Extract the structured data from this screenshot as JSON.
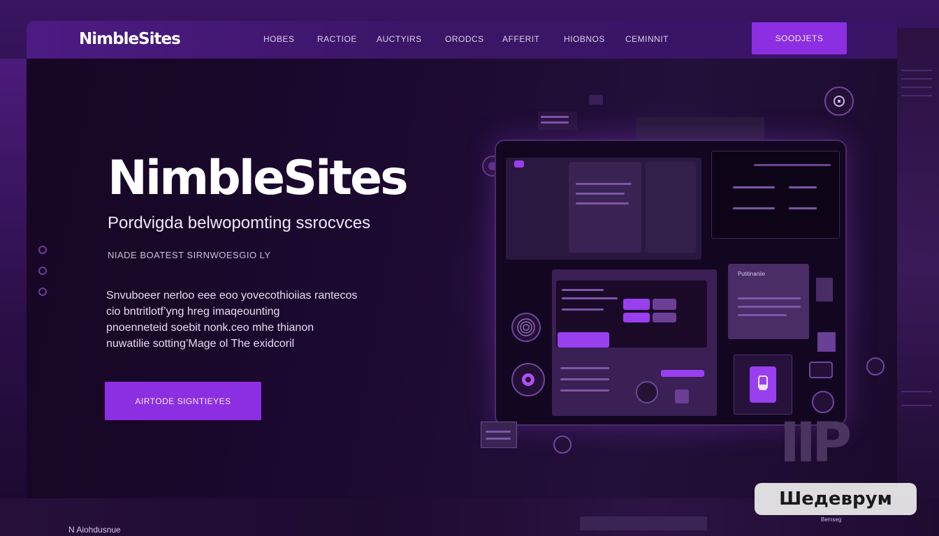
{
  "brand": {
    "logo": "NimbleSites"
  },
  "nav": {
    "links": [
      "HOBES",
      "RACTIOE",
      "AUCTYIRS",
      "ORODCS",
      "AFFERIT",
      "HIOBNOS",
      "CEMINNIT"
    ],
    "cta": "SOODJETS"
  },
  "hero": {
    "title": "NimbleSites",
    "subtitle": "Pordvigda belwopomting ssrocvces",
    "kicker": "NIADE BOATEST SIRNWOESGIO LY",
    "body": [
      "Snvuboeer nerloo eee eoo yovecothioiias rantecos",
      "cio bntritlotf’yng hreg imaqeounting",
      "pnoenneteid soebit nonk.ceo mhe thianon",
      "nuwatilie sotting’Mage ol The exidcoril"
    ],
    "cta": "AIRTODE SIGNTIEYES"
  },
  "mockup": {
    "card_header": "Putitinaniie",
    "big_letters": "IIP"
  },
  "footer": {
    "brand": "N Aiohdusnue",
    "mini_label": "Bemseg"
  },
  "watermark": {
    "label": "Шедеврум"
  },
  "colors": {
    "accent": "#8c2ee2",
    "nav_bg": "#4d1b84",
    "hero_bg": "#1c0930",
    "watermark_bg": "#eeeeee"
  },
  "icons": [
    "play-circle-icon",
    "gear-icon",
    "fingerprint-icon",
    "lock-icon",
    "cup-icon",
    "chat-icon"
  ]
}
